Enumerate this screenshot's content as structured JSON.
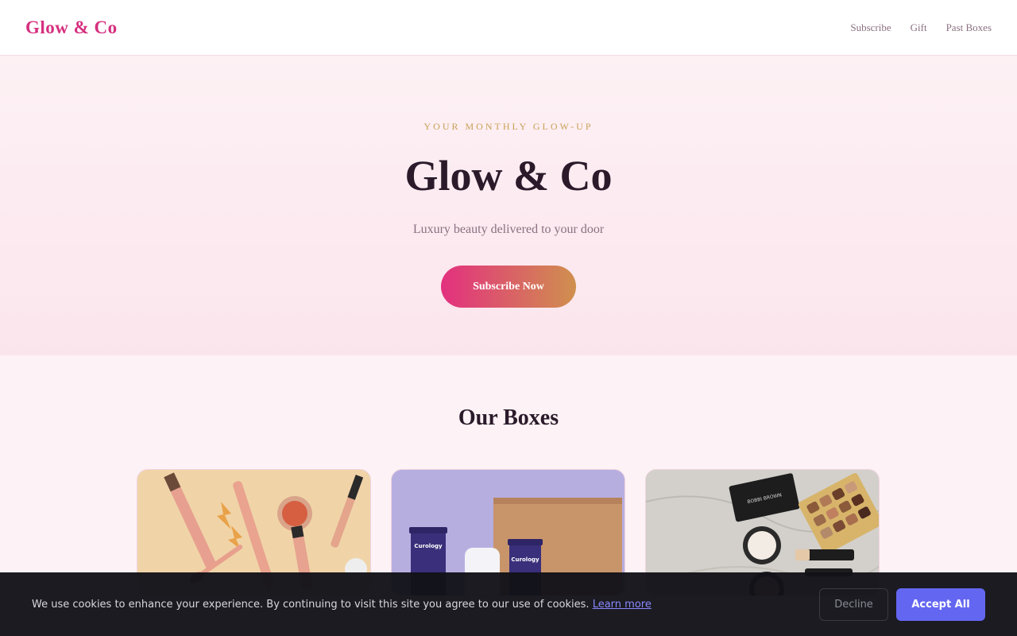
{
  "header": {
    "logo": "Glow & Co",
    "nav": [
      "Subscribe",
      "Gift",
      "Past Boxes"
    ]
  },
  "hero": {
    "eyebrow": "YOUR MONTHLY GLOW-UP",
    "title": "Glow & Co",
    "subtitle": "Luxury beauty delivered to your door",
    "cta": "Subscribe Now"
  },
  "boxes": {
    "title": "Our Boxes",
    "card2_brand": "Curology",
    "card3_brand": "BOBBI BROWN"
  },
  "cookie": {
    "text": "We use cookies to enhance your experience. By continuing to visit this site you agree to our use of cookies.",
    "link": "Learn more",
    "decline": "Decline",
    "accept": "Accept All"
  },
  "colors": {
    "brand": "#d6307f",
    "accent_gold": "#c9a058",
    "accept_button": "#6366f1"
  }
}
